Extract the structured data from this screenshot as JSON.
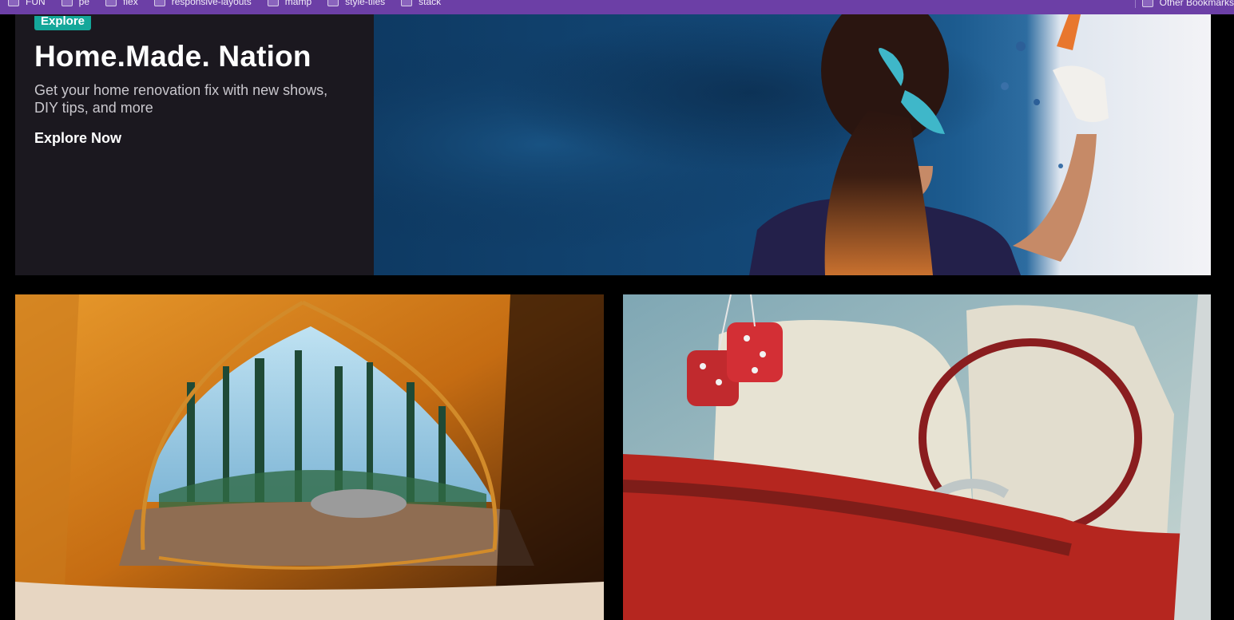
{
  "bookmarks": {
    "items": [
      {
        "label": "FUN"
      },
      {
        "label": "pe"
      },
      {
        "label": "flex"
      },
      {
        "label": "responsive-layouts"
      },
      {
        "label": "mamp"
      },
      {
        "label": "style-tiles"
      },
      {
        "label": "stack"
      }
    ],
    "other_label": "Other Bookmarks"
  },
  "hero": {
    "badge": "Explore",
    "title": "Home.Made. Nation",
    "description": "Get your home renovation fix with new shows, DIY tips, and more",
    "cta": "Explore Now"
  },
  "colors": {
    "bookmarks_bar": "#6c3fa6",
    "badge": "#14a79a",
    "hero_panel": "#1b181f",
    "page_background": "#000000"
  },
  "images": {
    "hero": "woman-painting-wall-image",
    "card1": "tent-view-forest-image",
    "card2": "vintage-car-interior-fuzzy-dice-image"
  }
}
